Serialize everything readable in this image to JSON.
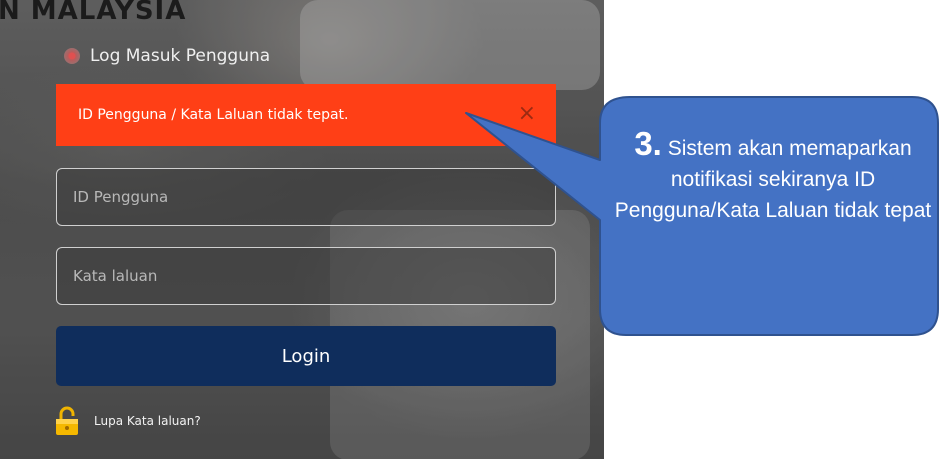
{
  "page": {
    "heading": "N MALAYSIA",
    "login_title": "Log Masuk Pengguna"
  },
  "alert": {
    "message": "ID Pengguna / Kata Laluan tidak tepat.",
    "close_label": "×"
  },
  "form": {
    "user_id_placeholder": "ID Pengguna",
    "password_placeholder": "Kata laluan",
    "login_label": "Login",
    "forgot_label": "Lupa Kata laluan?"
  },
  "callout": {
    "number": "3.",
    "text": "Sistem akan memaparkan notifikasi sekiranya ID Pengguna/Kata Laluan tidak tepat"
  },
  "colors": {
    "alert": "#ff3f16",
    "button": "#0f2d5c",
    "callout_fill": "#4472c4",
    "callout_border": "#2f528f"
  }
}
